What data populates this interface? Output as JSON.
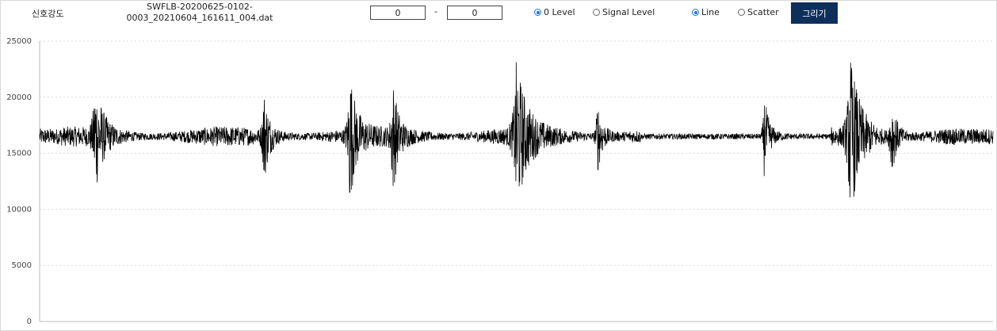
{
  "toolbar": {
    "title": "신호강도",
    "filename_line1": "SWFLB-20200625-0102-",
    "filename_line2": "0003_20210604_161611_004.dat",
    "range_start": "0",
    "range_sep": "-",
    "range_end": "0",
    "level_options": [
      {
        "label": "0 Level",
        "checked": true
      },
      {
        "label": "Signal Level",
        "checked": false
      }
    ],
    "plot_options": [
      {
        "label": "Line",
        "checked": true
      },
      {
        "label": "Scatter",
        "checked": false
      }
    ],
    "draw_label": "그리기",
    "accent_color": "#1a73e8",
    "button_color": "#0e2f5c"
  },
  "chart_data": {
    "type": "line",
    "title": "",
    "xlabel": "",
    "ylabel": "",
    "ylim": [
      0,
      25000
    ],
    "yticks": [
      0,
      5000,
      10000,
      15000,
      20000,
      25000
    ],
    "ytick_labels": [
      "0",
      "5000",
      "10000",
      "15000",
      "20000",
      "25000"
    ],
    "grid": true,
    "baseline": 16500,
    "line_color": "#000000",
    "series": [
      {
        "values_note_bursts": [
          {
            "x": 0.058,
            "amp": 4700,
            "w": 0.015
          },
          {
            "x": 0.235,
            "amp": 4000,
            "w": 0.01
          },
          {
            "x": 0.325,
            "amp": 5700,
            "w": 0.013
          },
          {
            "x": 0.37,
            "amp": 5000,
            "w": 0.01
          },
          {
            "x": 0.5,
            "amp": 6200,
            "w": 0.02
          },
          {
            "x": 0.585,
            "amp": 3200,
            "w": 0.01
          },
          {
            "x": 0.76,
            "amp": 3500,
            "w": 0.01
          },
          {
            "x": 0.85,
            "amp": 6800,
            "w": 0.02
          },
          {
            "x": 0.893,
            "amp": 3500,
            "w": 0.01
          }
        ]
      }
    ]
  }
}
